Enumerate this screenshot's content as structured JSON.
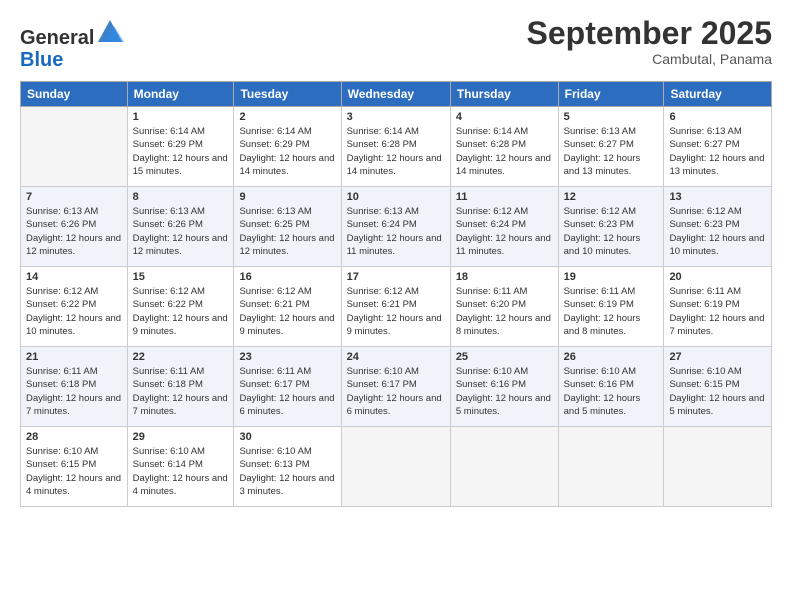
{
  "logo": {
    "general": "General",
    "blue": "Blue"
  },
  "header": {
    "month": "September 2025",
    "location": "Cambutal, Panama"
  },
  "weekdays": [
    "Sunday",
    "Monday",
    "Tuesday",
    "Wednesday",
    "Thursday",
    "Friday",
    "Saturday"
  ],
  "weeks": [
    [
      {
        "day": "",
        "empty": true
      },
      {
        "day": "1",
        "sunrise": "Sunrise: 6:14 AM",
        "sunset": "Sunset: 6:29 PM",
        "daylight": "Daylight: 12 hours and 15 minutes."
      },
      {
        "day": "2",
        "sunrise": "Sunrise: 6:14 AM",
        "sunset": "Sunset: 6:29 PM",
        "daylight": "Daylight: 12 hours and 14 minutes."
      },
      {
        "day": "3",
        "sunrise": "Sunrise: 6:14 AM",
        "sunset": "Sunset: 6:28 PM",
        "daylight": "Daylight: 12 hours and 14 minutes."
      },
      {
        "day": "4",
        "sunrise": "Sunrise: 6:14 AM",
        "sunset": "Sunset: 6:28 PM",
        "daylight": "Daylight: 12 hours and 14 minutes."
      },
      {
        "day": "5",
        "sunrise": "Sunrise: 6:13 AM",
        "sunset": "Sunset: 6:27 PM",
        "daylight": "Daylight: 12 hours and 13 minutes."
      },
      {
        "day": "6",
        "sunrise": "Sunrise: 6:13 AM",
        "sunset": "Sunset: 6:27 PM",
        "daylight": "Daylight: 12 hours and 13 minutes."
      }
    ],
    [
      {
        "day": "7",
        "sunrise": "Sunrise: 6:13 AM",
        "sunset": "Sunset: 6:26 PM",
        "daylight": "Daylight: 12 hours and 12 minutes."
      },
      {
        "day": "8",
        "sunrise": "Sunrise: 6:13 AM",
        "sunset": "Sunset: 6:26 PM",
        "daylight": "Daylight: 12 hours and 12 minutes."
      },
      {
        "day": "9",
        "sunrise": "Sunrise: 6:13 AM",
        "sunset": "Sunset: 6:25 PM",
        "daylight": "Daylight: 12 hours and 12 minutes."
      },
      {
        "day": "10",
        "sunrise": "Sunrise: 6:13 AM",
        "sunset": "Sunset: 6:24 PM",
        "daylight": "Daylight: 12 hours and 11 minutes."
      },
      {
        "day": "11",
        "sunrise": "Sunrise: 6:12 AM",
        "sunset": "Sunset: 6:24 PM",
        "daylight": "Daylight: 12 hours and 11 minutes."
      },
      {
        "day": "12",
        "sunrise": "Sunrise: 6:12 AM",
        "sunset": "Sunset: 6:23 PM",
        "daylight": "Daylight: 12 hours and 10 minutes."
      },
      {
        "day": "13",
        "sunrise": "Sunrise: 6:12 AM",
        "sunset": "Sunset: 6:23 PM",
        "daylight": "Daylight: 12 hours and 10 minutes."
      }
    ],
    [
      {
        "day": "14",
        "sunrise": "Sunrise: 6:12 AM",
        "sunset": "Sunset: 6:22 PM",
        "daylight": "Daylight: 12 hours and 10 minutes."
      },
      {
        "day": "15",
        "sunrise": "Sunrise: 6:12 AM",
        "sunset": "Sunset: 6:22 PM",
        "daylight": "Daylight: 12 hours and 9 minutes."
      },
      {
        "day": "16",
        "sunrise": "Sunrise: 6:12 AM",
        "sunset": "Sunset: 6:21 PM",
        "daylight": "Daylight: 12 hours and 9 minutes."
      },
      {
        "day": "17",
        "sunrise": "Sunrise: 6:12 AM",
        "sunset": "Sunset: 6:21 PM",
        "daylight": "Daylight: 12 hours and 9 minutes."
      },
      {
        "day": "18",
        "sunrise": "Sunrise: 6:11 AM",
        "sunset": "Sunset: 6:20 PM",
        "daylight": "Daylight: 12 hours and 8 minutes."
      },
      {
        "day": "19",
        "sunrise": "Sunrise: 6:11 AM",
        "sunset": "Sunset: 6:19 PM",
        "daylight": "Daylight: 12 hours and 8 minutes."
      },
      {
        "day": "20",
        "sunrise": "Sunrise: 6:11 AM",
        "sunset": "Sunset: 6:19 PM",
        "daylight": "Daylight: 12 hours and 7 minutes."
      }
    ],
    [
      {
        "day": "21",
        "sunrise": "Sunrise: 6:11 AM",
        "sunset": "Sunset: 6:18 PM",
        "daylight": "Daylight: 12 hours and 7 minutes."
      },
      {
        "day": "22",
        "sunrise": "Sunrise: 6:11 AM",
        "sunset": "Sunset: 6:18 PM",
        "daylight": "Daylight: 12 hours and 7 minutes."
      },
      {
        "day": "23",
        "sunrise": "Sunrise: 6:11 AM",
        "sunset": "Sunset: 6:17 PM",
        "daylight": "Daylight: 12 hours and 6 minutes."
      },
      {
        "day": "24",
        "sunrise": "Sunrise: 6:10 AM",
        "sunset": "Sunset: 6:17 PM",
        "daylight": "Daylight: 12 hours and 6 minutes."
      },
      {
        "day": "25",
        "sunrise": "Sunrise: 6:10 AM",
        "sunset": "Sunset: 6:16 PM",
        "daylight": "Daylight: 12 hours and 5 minutes."
      },
      {
        "day": "26",
        "sunrise": "Sunrise: 6:10 AM",
        "sunset": "Sunset: 6:16 PM",
        "daylight": "Daylight: 12 hours and 5 minutes."
      },
      {
        "day": "27",
        "sunrise": "Sunrise: 6:10 AM",
        "sunset": "Sunset: 6:15 PM",
        "daylight": "Daylight: 12 hours and 5 minutes."
      }
    ],
    [
      {
        "day": "28",
        "sunrise": "Sunrise: 6:10 AM",
        "sunset": "Sunset: 6:15 PM",
        "daylight": "Daylight: 12 hours and 4 minutes."
      },
      {
        "day": "29",
        "sunrise": "Sunrise: 6:10 AM",
        "sunset": "Sunset: 6:14 PM",
        "daylight": "Daylight: 12 hours and 4 minutes."
      },
      {
        "day": "30",
        "sunrise": "Sunrise: 6:10 AM",
        "sunset": "Sunset: 6:13 PM",
        "daylight": "Daylight: 12 hours and 3 minutes."
      },
      {
        "day": "",
        "empty": true
      },
      {
        "day": "",
        "empty": true
      },
      {
        "day": "",
        "empty": true
      },
      {
        "day": "",
        "empty": true
      }
    ]
  ]
}
